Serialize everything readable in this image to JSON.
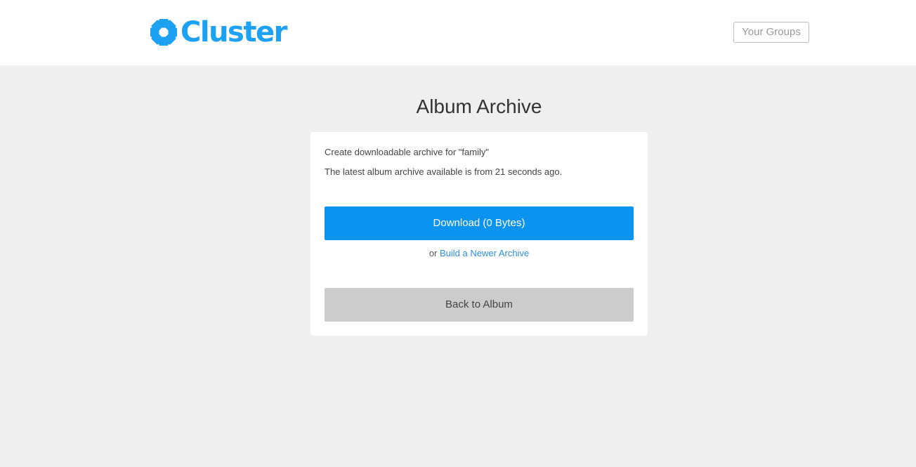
{
  "header": {
    "logo_text": "Cluster",
    "groups_label": "Your Groups"
  },
  "main": {
    "title": "Album Archive",
    "archive_for_text": "Create downloadable archive for \"family\"",
    "latest_text": "The latest album archive available is from 21 seconds ago.",
    "download_label": "Download (0 Bytes)",
    "or_text": "or",
    "build_link_label": "Build a Newer Archive",
    "back_label": "Back to Album"
  },
  "colors": {
    "brand": "#1da1f2",
    "primary_button": "#0b93f0",
    "secondary_button": "#cccccc",
    "link": "#2b8fe0",
    "background": "#efefef"
  },
  "icons": {
    "logo": "cluster-flower-icon"
  }
}
